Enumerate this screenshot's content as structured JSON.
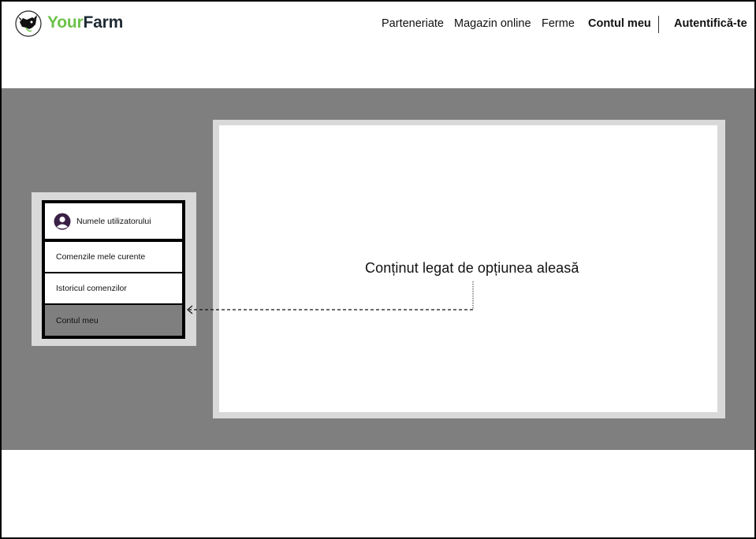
{
  "header": {
    "brand_your": "Your",
    "brand_farm": "Farm",
    "logo_icon": "cow-logo-icon",
    "nav": [
      {
        "label": "Parteneriate"
      },
      {
        "label": "Magazin online"
      },
      {
        "label": "Ferme"
      },
      {
        "label": "Contul meu"
      }
    ],
    "login_label": "Autentifică-te"
  },
  "sidebar": {
    "user_name": "Numele utilizatorului",
    "avatar_icon": "user-avatar-icon",
    "items": [
      {
        "label": "Comenzile mele curente"
      },
      {
        "label": "Istoricul comenzilor"
      },
      {
        "label": "Contul meu",
        "selected": true
      }
    ]
  },
  "content": {
    "text": "Conținut legat de opțiunea aleasă"
  },
  "colors": {
    "brand_green": "#6cc24a",
    "brand_dark": "#1f2a33",
    "band_gray": "#7f7f7f",
    "panel_light_gray": "#d9d9d9"
  }
}
